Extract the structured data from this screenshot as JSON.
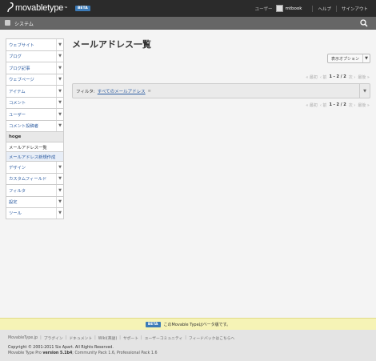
{
  "header": {
    "brand": "movabletype",
    "tm": "™",
    "beta": "BETA",
    "user_label": "ユーザー",
    "username": "mtbook",
    "help": "ヘルプ",
    "signout": "サインアウト"
  },
  "sysbar": {
    "label": "システム"
  },
  "sidebar": {
    "items": [
      {
        "label": "ウェブサイト"
      },
      {
        "label": "ブログ"
      },
      {
        "label": "ブログ記事"
      },
      {
        "label": "ウェブページ"
      },
      {
        "label": "アイテム"
      },
      {
        "label": "コメント"
      },
      {
        "label": "ユーザー"
      },
      {
        "label": "コメント投稿者"
      }
    ],
    "blog_name": "hoge",
    "sub_items": [
      {
        "label": "メールアドレス一覧"
      },
      {
        "label": "メールアドレス新規作成"
      }
    ],
    "items2": [
      {
        "label": "デザイン"
      },
      {
        "label": "カスタムフィールド"
      },
      {
        "label": "フィルタ"
      },
      {
        "label": "設定"
      },
      {
        "label": "ツール"
      }
    ]
  },
  "main": {
    "title": "メールアドレス一覧",
    "display_options": "表示オプション",
    "pager": {
      "first": "« 最初",
      "prev": "‹ 前",
      "range": "1 - 2 / 2",
      "next": "次 ›",
      "last": "最後 »"
    },
    "filter_label": "フィルタ:",
    "filter_value": "すべてのメールアドレス",
    "filter_clear": "≡"
  },
  "beta_banner": {
    "badge": "BETA",
    "text": "このMovable Typeはベータ版です。"
  },
  "footer": {
    "links": [
      "MovableType.jp",
      "プラグイン",
      "ドキュメント",
      "Wiki(英語)",
      "サポート",
      "ユーザーコミュニティ",
      "フィードバックはこちらへ"
    ],
    "copyright": "Copyright © 2001-2011 Six Apart. All Rights Reserved.",
    "version_prefix": "Movable Type Pro",
    "version_bold": "version 5.1b4",
    "version_suffix": "; Community Pack 1.6, Professional Pack 1.6"
  }
}
